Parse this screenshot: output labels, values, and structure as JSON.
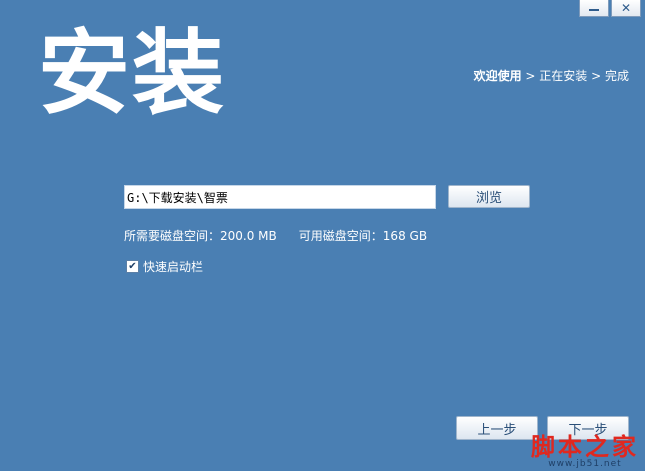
{
  "window": {
    "minimize_icon": "minimize-icon",
    "close_glyph": "✕"
  },
  "header": {
    "title": "安装",
    "breadcrumb": {
      "step1": "欢迎使用",
      "sep1": " > ",
      "step2": "正在安装",
      "sep2": " > ",
      "step3": "完成"
    }
  },
  "install_path": {
    "value": "G:\\下载安装\\智票",
    "browse_label": "浏览"
  },
  "disk": {
    "required_label": "所需要磁盘空间：",
    "required_value": "200.0 MB",
    "available_label": "可用磁盘空间：",
    "available_value": "168 GB"
  },
  "options": {
    "quick_launch_label": "快速启动栏",
    "quick_launch_checked": true,
    "check_glyph": "✔"
  },
  "footer": {
    "prev_label": "上一步",
    "next_label": "下一步"
  },
  "watermark": {
    "main": "脚本之家",
    "sub": "www.jb51.net"
  },
  "colors": {
    "background": "#4a7fb3",
    "watermark": "#e0281f"
  }
}
